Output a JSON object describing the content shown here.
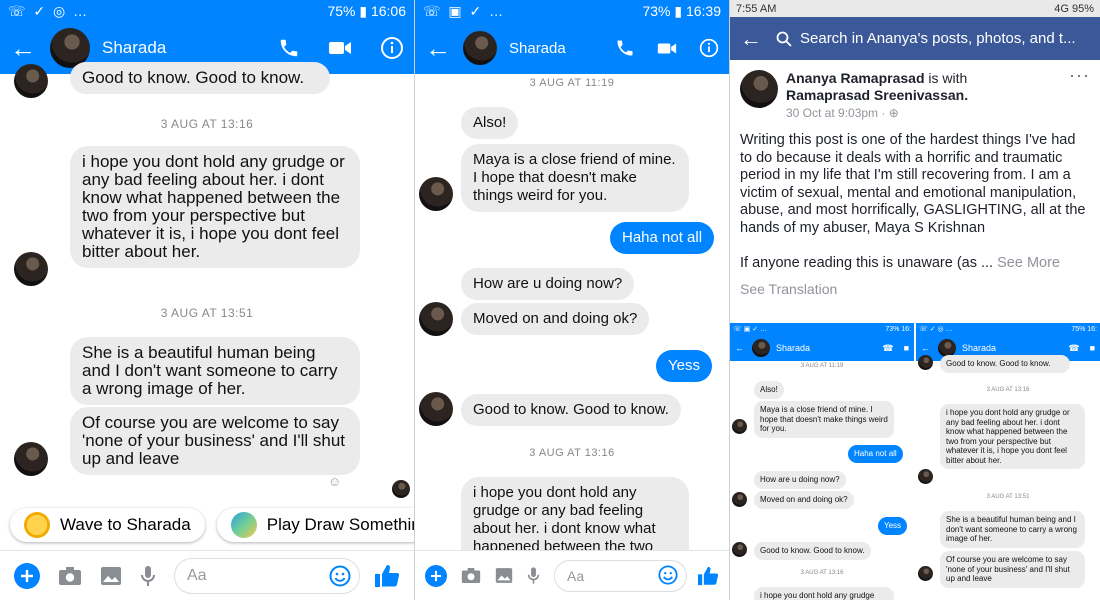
{
  "colors": {
    "messenger_blue": "#0084ff",
    "facebook_blue": "#3b5998",
    "bubble_gray": "#ebebeb"
  },
  "panel1": {
    "status": {
      "left_icons": "☏ ✓ ◎ …",
      "right": "75% ▮ 16:06"
    },
    "contact_name": "Sharada",
    "messages": [
      {
        "text": "Good to know. Good to know."
      },
      {
        "date": "3 AUG AT 13:16"
      },
      {
        "text": "i hope you dont hold any grudge or any bad feeling about her. i dont know what happened between the two from your perspective but whatever it is, i hope you dont feel bitter about her."
      },
      {
        "date": "3 AUG AT 13:51"
      },
      {
        "text": "She is a beautiful human being and I don't want someone to carry a wrong image of her."
      },
      {
        "text": "Of course you are welcome to say 'none of your business' and I'll shut up and leave"
      }
    ],
    "chips": [
      "Wave to Sharada",
      "Play Draw Somethin"
    ],
    "composer_placeholder": "Aa"
  },
  "panel2": {
    "status": {
      "left_icons": "☏ ▣ ✓ …",
      "right": "73% ▮ 16:39"
    },
    "contact_name": "Sharada",
    "date1": "3 AUG AT 11:19",
    "msg_also": "Also!",
    "msg_maya": "Maya is a close friend of mine. I hope that doesn't make things weird for you.",
    "msg_haha": "Haha not all",
    "msg_how": "How are u doing now?",
    "msg_moved": "Moved on and doing ok?",
    "msg_yess": "Yess",
    "msg_good": "Good to know. Good to know.",
    "date2": "3 AUG AT 13:16",
    "msg_grudge": "i hope you dont hold any grudge or any bad feeling about her. i dont know what happened between the two from your",
    "composer_placeholder": "Aa"
  },
  "panel3": {
    "status": {
      "time": "7:55 AM",
      "right": "4G 95%"
    },
    "search": "Search in Ananya's posts, photos, and t...",
    "author_name": "Ananya Ramaprasad",
    "is_with": "is with",
    "with_name": "Ramaprasad Sreenivassan.",
    "meta": "30 Oct at 9:03pm · ",
    "body": "Writing this post is one of the hardest things I've had to do because it deals with a horrific and traumatic period in my life that I'm still recovering from. I am a victim of sexual, mental and emotional manipulation, abuse, and most horrifically, GASLIGHTING, all at the hands of my abuser, Maya S Krishnan",
    "body2": "If anyone reading this is unaware (as ... ",
    "see_more": "See More",
    "see_translation": "See Translation",
    "mini_left": {
      "status": "73% 16:",
      "name": "Sharada",
      "date1": "3 AUG AT 11:19",
      "also": "Also!",
      "maya": "Maya is a close friend of mine. I hope that doesn't make things weird for you.",
      "haha": "Haha not all",
      "how": "How are u doing now?",
      "moved": "Moved on and doing ok?",
      "yess": "Yess",
      "good": "Good to know. Good to know.",
      "date2": "3 AUG AT 13:16",
      "grudge": "i hope you dont hold any grudge"
    },
    "mini_right": {
      "status": "75% 16:",
      "name": "Sharada",
      "good": "Good to know. Good to know.",
      "date1": "3 AUG AT 13:16",
      "grudge": "i hope you dont hold any grudge or any bad feeling about her. i dont know what happened between the two from your perspective but whatever it is, i hope you dont feel bitter about her.",
      "date2": "3 AUG AT 13:51",
      "beautiful": "She is a beautiful human being and I don't want someone to carry a wrong image of her.",
      "course": "Of course you are welcome to say 'none of your business' and I'll shut up and leave"
    }
  }
}
